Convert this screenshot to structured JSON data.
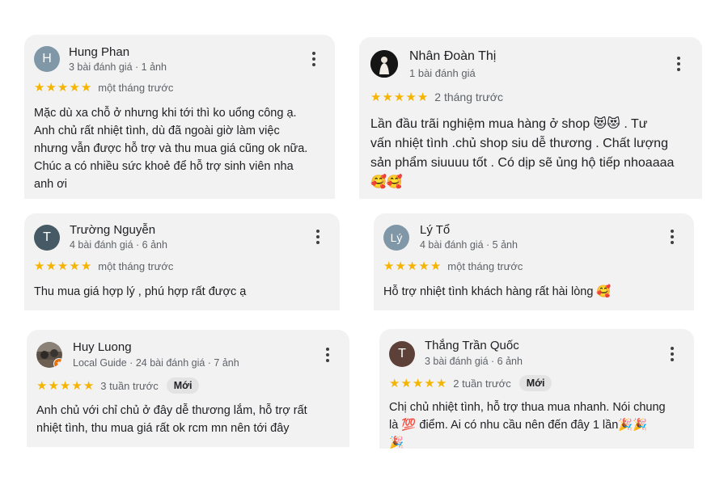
{
  "reviews": [
    {
      "name": "Hung Phan",
      "meta": "3 bài đánh giá · 1 ảnh",
      "avatar_letter": "H",
      "avatar_color": "#7f97a7",
      "stars": 5,
      "when": "một tháng trước",
      "text": "Mặc dù xa chỗ ở nhưng khi tới thì ko uổng công ạ.\nAnh chủ rất nhiệt tình, dù đã ngoài giờ làm việc\nnhưng vẫn được hỗ trợ và thu mua giá cũng ok nữa.\nChúc a có nhiều sức khoẻ để hỗ trợ sinh viên nha\nanh ơi"
    },
    {
      "name": "Nhân Đoàn Thị",
      "meta": "1 bài đánh giá",
      "avatar_icon": "profile-photo",
      "stars": 5,
      "when": "2 tháng trước",
      "text": "Lần đầu trãi nghiệm mua hàng ở shop 😻😻 . Tư\nvấn nhiệt tình .chủ shop siu dễ thương . Chất lượng\nsản phẩm siuuuu tốt . Có dịp sẽ ủng hộ tiếp nhoaaaa\n🥰🥰"
    },
    {
      "name": "Trường Nguyễn",
      "meta": "4 bài đánh giá · 6 ảnh",
      "avatar_letter": "T",
      "avatar_color": "#455a64",
      "stars": 5,
      "when": "một tháng trước",
      "text": "Thu mua giá hợp lý , phú hợp rất được ạ"
    },
    {
      "name": "Lý Tổ",
      "meta": "4 bài đánh giá · 5 ảnh",
      "avatar_letter": "Lý",
      "avatar_color": "#7f97a7",
      "stars": 5,
      "when": "một tháng trước",
      "text": "Hỗ trợ nhiệt tình khách hàng rất hài lòng 🥰"
    },
    {
      "name": "Huy Luong",
      "meta": "Local Guide · 24 bài đánh giá · 7 ảnh",
      "avatar_icon": "profile-photo-local-guide",
      "stars": 5,
      "when": "3 tuần trước",
      "badge": "Mới",
      "text": "Anh chủ với chỉ chủ ở đây dễ thương lắm, hỗ trợ rất\nnhiệt tình, thu mua giá rất ok rcm mn nên tới đây"
    },
    {
      "name": "Thắng Trần Quốc",
      "meta": "3 bài đánh giá · 6 ảnh",
      "avatar_letter": "T",
      "avatar_color": "#5d4037",
      "stars": 5,
      "when": "2 tuần trước",
      "badge": "Mới",
      "text": "Chị chủ nhiệt tình, hỗ trợ thua mua nhanh. Nói chung\nlà 💯 điểm. Ai có nhu cầu nên đến đây 1 lần🎉🎉\n🎉"
    }
  ],
  "colors": {
    "star": "#f4b400",
    "card_bg": "#f2f2f2"
  }
}
